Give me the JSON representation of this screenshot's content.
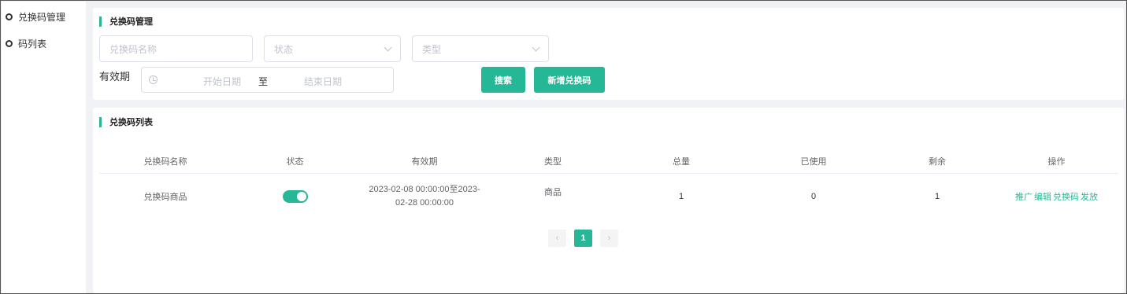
{
  "sidebar": {
    "items": [
      {
        "label": "兑换码管理"
      },
      {
        "label": "码列表"
      }
    ]
  },
  "filter": {
    "section_title": "兑换码管理",
    "name_placeholder": "兑换码名称",
    "status_placeholder": "状态",
    "type_placeholder": "类型",
    "valid_label": "有效期",
    "start_placeholder": "开始日期",
    "range_separator": "至",
    "end_placeholder": "结束日期",
    "search_button": "搜索",
    "add_button": "新增兑换码"
  },
  "list": {
    "section_title": "兑换码列表",
    "columns": [
      "兑换码名称",
      "状态",
      "有效期",
      "类型",
      "总量",
      "已使用",
      "剩余",
      "操作"
    ],
    "rows": [
      {
        "name": "兑换码商品",
        "status_on": true,
        "valid_line1": "2023-02-08 00:00:00至2023-",
        "valid_line2": "02-28 00:00:00",
        "type": "商品",
        "total": "1",
        "used": "0",
        "remain": "1",
        "actions": [
          "推广",
          "编辑",
          "兑换码",
          "发放"
        ]
      }
    ]
  },
  "pagination": {
    "prev": "‹",
    "current": "1",
    "next": "›"
  },
  "colors": {
    "accent": "#26b896"
  }
}
